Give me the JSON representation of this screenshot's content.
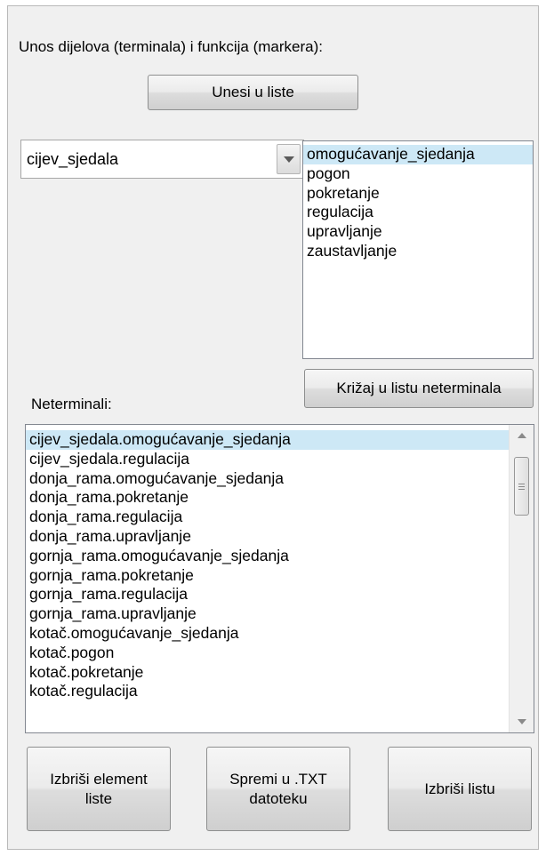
{
  "terminals": {
    "label": "Unos dijelova (terminala) i funkcija (markera):",
    "enter_button": "Unesi u liste"
  },
  "parts_combo": {
    "value": "cijev_sjedala",
    "icon": "chevron-down-icon"
  },
  "functions_list": {
    "items": [
      {
        "label": "omogućavanje_sjedanja",
        "selected": true
      },
      {
        "label": "pogon",
        "selected": false
      },
      {
        "label": "pokretanje",
        "selected": false
      },
      {
        "label": "regulacija",
        "selected": false
      },
      {
        "label": "upravljanje",
        "selected": false
      },
      {
        "label": "zaustavljanje",
        "selected": false
      }
    ]
  },
  "cross_button": "Križaj u listu neterminala",
  "nonterminals": {
    "label": "Neterminali:",
    "items": [
      {
        "label": "cijev_sjedala.omogućavanje_sjedanja",
        "selected": true
      },
      {
        "label": "cijev_sjedala.regulacija",
        "selected": false
      },
      {
        "label": "donja_rama.omogućavanje_sjedanja",
        "selected": false
      },
      {
        "label": "donja_rama.pokretanje",
        "selected": false
      },
      {
        "label": "donja_rama.regulacija",
        "selected": false
      },
      {
        "label": "donja_rama.upravljanje",
        "selected": false
      },
      {
        "label": "gornja_rama.omogućavanje_sjedanja",
        "selected": false
      },
      {
        "label": "gornja_rama.pokretanje",
        "selected": false
      },
      {
        "label": "gornja_rama.regulacija",
        "selected": false
      },
      {
        "label": "gornja_rama.upravljanje",
        "selected": false
      },
      {
        "label": "kotač.omogućavanje_sjedanja",
        "selected": false
      },
      {
        "label": "kotač.pogon",
        "selected": false
      },
      {
        "label": "kotač.pokretanje",
        "selected": false
      },
      {
        "label": "kotač.regulacija",
        "selected": false
      }
    ]
  },
  "bottom_buttons": {
    "delete_element": "Izbriši element\nliste",
    "save_txt": "Spremi u .TXT\ndatoteku",
    "delete_list": "Izbriši listu"
  },
  "colors": {
    "panel_bg": "#f0f0f0",
    "selection_bg": "#cde8f6",
    "border": "#828790"
  }
}
